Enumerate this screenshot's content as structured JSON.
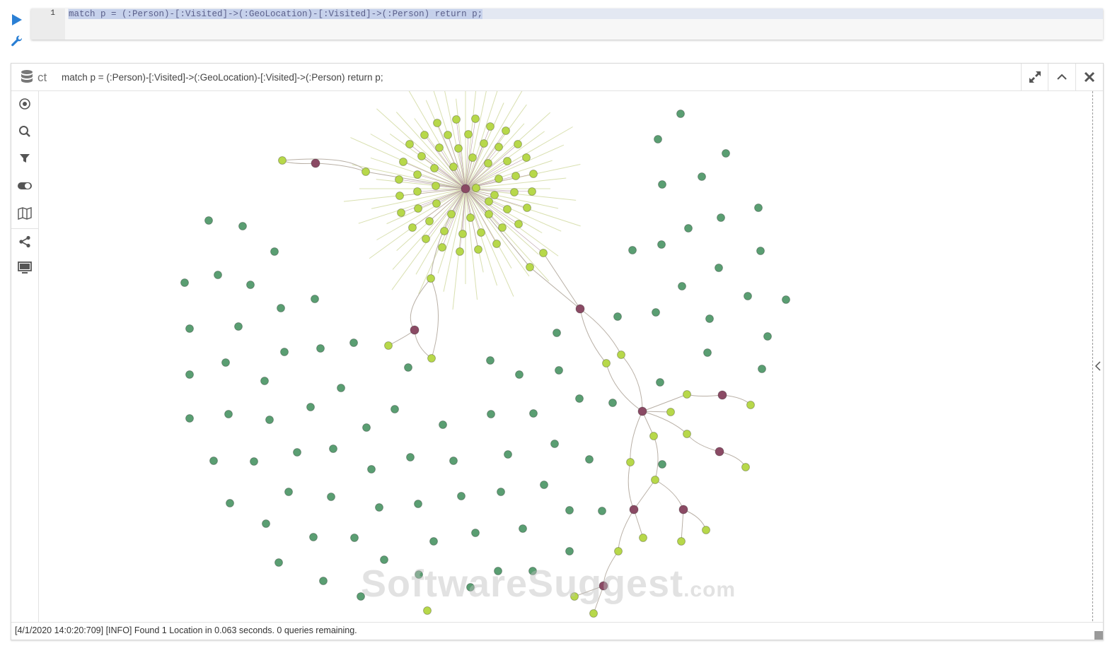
{
  "toolbar": {
    "run_icon": "play-icon",
    "settings_icon": "wrench-icon"
  },
  "editor": {
    "line_number": "1",
    "query": "match p = (:Person)-[:Visited]->(:GeoLocation)-[:Visited]->(:Person) return p;"
  },
  "panel": {
    "db_label": "ct",
    "query_title": "match p = (:Person)-[:Visited]->(:GeoLocation)-[:Visited]->(:Person) return p;",
    "buttons": [
      "expand-icon",
      "collapse-icon",
      "close-icon"
    ]
  },
  "sidebar": [
    "center-icon",
    "search-icon",
    "filter-icon",
    "toggle-icon",
    "map-icon",
    "share-icon",
    "monitor-icon"
  ],
  "status": {
    "message": "[4/1/2020 14:0:20:709] [INFO] Found 1 Location in 0.063 seconds. 0 queries remaining."
  },
  "watermark": {
    "main": "SoftwareSuggest",
    "suffix": ".com"
  },
  "colors": {
    "person_node": "#8a4a64",
    "location_node": "#b7d84a",
    "isolated_node": "#5a9e72",
    "accent": "#2a7fd4",
    "edge": "#b9b0a6"
  }
}
